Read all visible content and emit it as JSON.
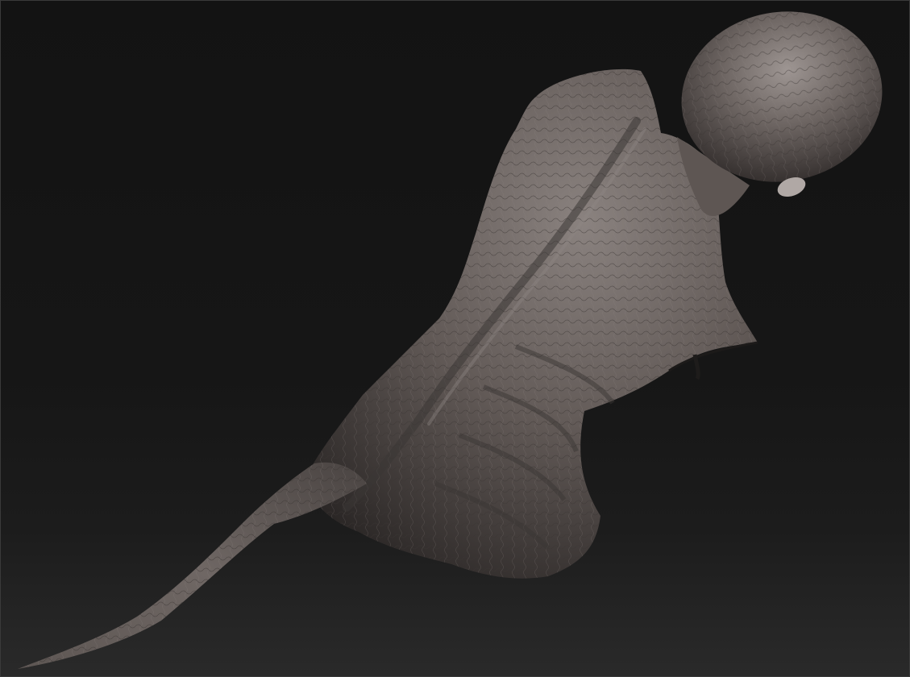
{
  "viewport": {
    "content": "3d-sculpt-model",
    "background_top": "#131313",
    "background_bottom": "#2a2a2a"
  },
  "model": {
    "base_color": "#6a625f",
    "shadow_color": "#2e2a29",
    "highlight_color": "#9b9390"
  }
}
